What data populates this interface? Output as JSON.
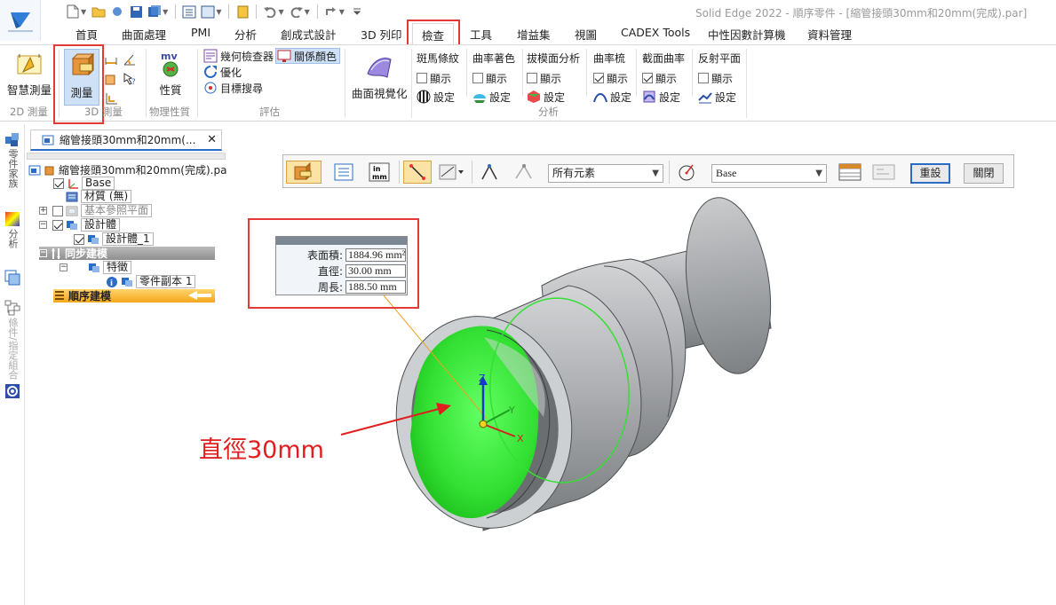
{
  "window": {
    "title": "Solid Edge 2022 - 順序零件 - [縮管接頭30mm和20mm(完成).par]"
  },
  "colors": {
    "accent": "#2b6cc4",
    "highlight_red": "#e53935",
    "selection_green": "#33e033",
    "part_grey": "#8f9295"
  },
  "ribbon_tabs": [
    "首頁",
    "曲面處理",
    "PMI",
    "分析",
    "創成式設計",
    "3D 列印",
    "檢查",
    "工具",
    "增益集",
    "視圖",
    "CADEX Tools",
    "中性因數計算機",
    "資料管理"
  ],
  "active_tab": "檢查",
  "ribbon": {
    "smart_measure": "智慧測量",
    "group_2d": "2D 測量",
    "measure": "測量",
    "group_3d": "3D 測量",
    "properties": "性質",
    "group_physical": "物理性質",
    "geometry_inspector": "幾何檢查器",
    "optimize": "優化",
    "target_search": "目標搜尋",
    "relation_color": "關係顏色",
    "group_evaluate": "評估",
    "surface_visualization": "曲面視覺化",
    "analysis_columns": [
      {
        "title": "斑馬條紋",
        "show": "顯示",
        "checked": false,
        "setting": "設定"
      },
      {
        "title": "曲率著色",
        "show": "顯示",
        "checked": false,
        "setting": "設定"
      },
      {
        "title": "拔模面分析",
        "show": "顯示",
        "checked": false,
        "setting": "設定"
      },
      {
        "title": "曲率梳",
        "show": "顯示",
        "checked": true,
        "setting": "設定"
      },
      {
        "title": "截面曲率",
        "show": "顯示",
        "checked": true,
        "setting": "設定"
      },
      {
        "title": "反射平面",
        "show": "顯示",
        "checked": false,
        "setting": "設定"
      }
    ],
    "group_analysis": "分析"
  },
  "side_strip": {
    "part_family": "零件家族",
    "analysis": "分析",
    "assembly_relations": "條件/指定組合"
  },
  "document_tab": {
    "label": "縮管接頭30mm和20mm(..."
  },
  "tree": {
    "root": "縮管接頭30mm和20mm(完成).pa",
    "base": "Base",
    "material": "材質 (無)",
    "ref_planes": "基本參照平面",
    "design_body": "設計體",
    "design_body_1": "設計體_1",
    "sync_modeling": "同步建模",
    "features": "特徵",
    "part_copy": "零件副本 1",
    "ordered_modeling": "順序建模"
  },
  "command_bar": {
    "select_filter": "所有元素",
    "coordinate_system": "Base",
    "reset": "重設",
    "close": "關閉"
  },
  "measure": {
    "area_label": "表面積:",
    "area_value": "1884.96 mm²",
    "diameter_label": "直徑:",
    "diameter_value": "30.00 mm",
    "perimeter_label": "周長:",
    "perimeter_value": "188.50 mm"
  },
  "annotation": {
    "text": "直徑30mm"
  },
  "triad": {
    "x": "X",
    "y": "Y",
    "z": "Z"
  }
}
